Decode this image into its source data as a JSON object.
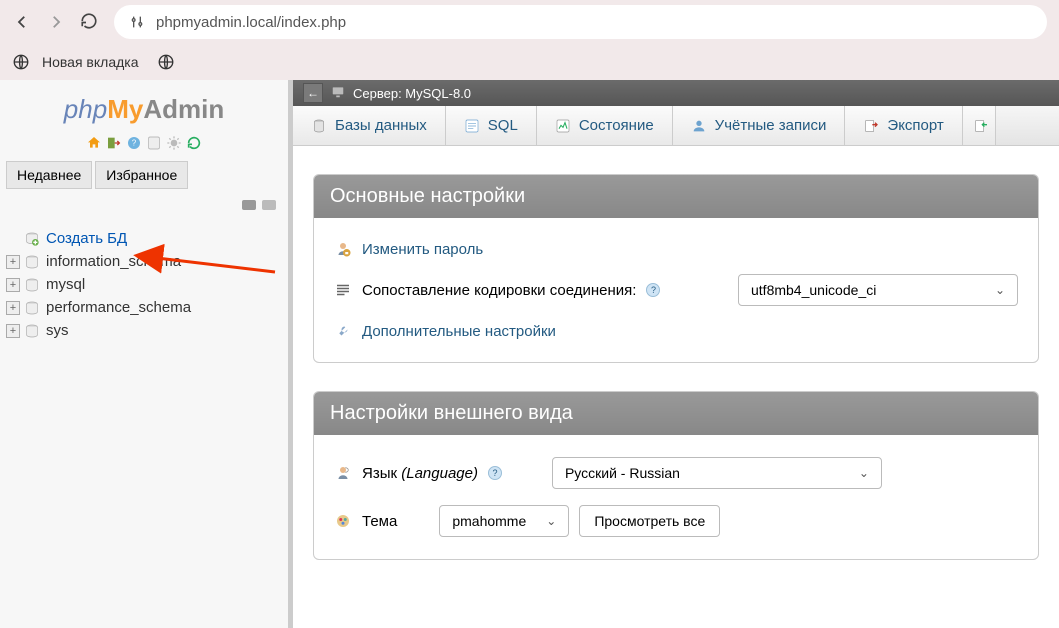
{
  "browser": {
    "url": "phpmyadmin.local/index.php",
    "bookmark_new_tab": "Новая вкладка"
  },
  "logo": {
    "p1": "php",
    "p2": "My",
    "p3": "Admin"
  },
  "sidebar_tabs": {
    "recent": "Недавнее",
    "favorite": "Избранное"
  },
  "tree": {
    "create": "Создать БД",
    "items": [
      "information_schema",
      "mysql",
      "performance_schema",
      "sys"
    ]
  },
  "server_bar": {
    "label": "Сервер: MySQL-8.0"
  },
  "top_tabs": {
    "databases": "Базы данных",
    "sql": "SQL",
    "status": "Состояние",
    "accounts": "Учётные записи",
    "export": "Экспорт"
  },
  "panels": {
    "general": {
      "title": "Основные настройки",
      "change_password": "Изменить пароль",
      "collation_label": "Сопоставление кодировки соединения:",
      "collation_value": "utf8mb4_unicode_ci",
      "more_settings": "Дополнительные настройки"
    },
    "appearance": {
      "title": "Настройки внешнего вида",
      "language_label": "Язык",
      "language_italic": "(Language)",
      "language_value": "Русский - Russian",
      "theme_label": "Тема",
      "theme_value": "pmahomme",
      "view_all": "Просмотреть все"
    }
  }
}
